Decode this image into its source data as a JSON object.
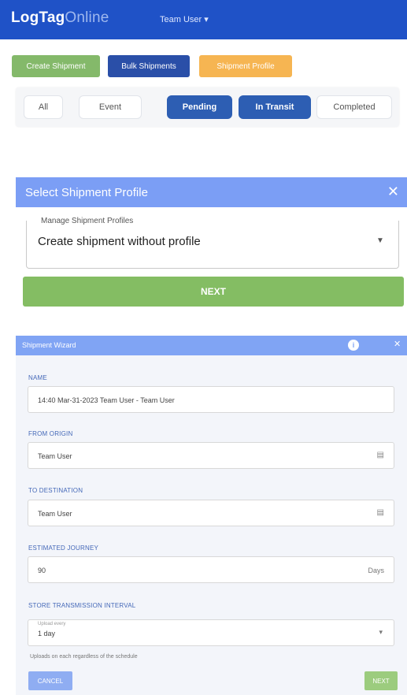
{
  "header": {
    "brand_main": "LogTag",
    "brand_suffix": "Online",
    "user_menu": "Team User ▾"
  },
  "actions": {
    "create_shipment": "Create Shipment",
    "bulk_shipments": "Bulk Shipments",
    "import_profile": "Shipment Profile"
  },
  "filters": {
    "all": "All",
    "event": "Event",
    "pending": "Pending",
    "in_transit": "In Transit",
    "completed": "Completed"
  },
  "profile_dialog": {
    "title": "Select Shipment Profile",
    "close": "✕",
    "field_label": "Manage Shipment Profiles",
    "field_value": "Create shipment without profile",
    "next": "NEXT"
  },
  "wizard": {
    "title": "Shipment Wizard",
    "info": "i",
    "close": "✕",
    "name_label": "NAME",
    "name_value": "14:40 Mar-31-2023 Team User - Team User",
    "origin_label": "FROM ORIGIN",
    "origin_value": "Team User",
    "destination_label": "TO DESTINATION",
    "destination_value": "Team User",
    "journey_label": "ESTIMATED JOURNEY",
    "journey_value": "90",
    "journey_unit": "Days",
    "interval_label": "STORE TRANSMISSION INTERVAL",
    "interval_sublabel": "Upload every",
    "interval_value": "1 day",
    "note": "Uploads on each regardless of the schedule",
    "cancel": "CANCEL",
    "next": "NEXT"
  }
}
